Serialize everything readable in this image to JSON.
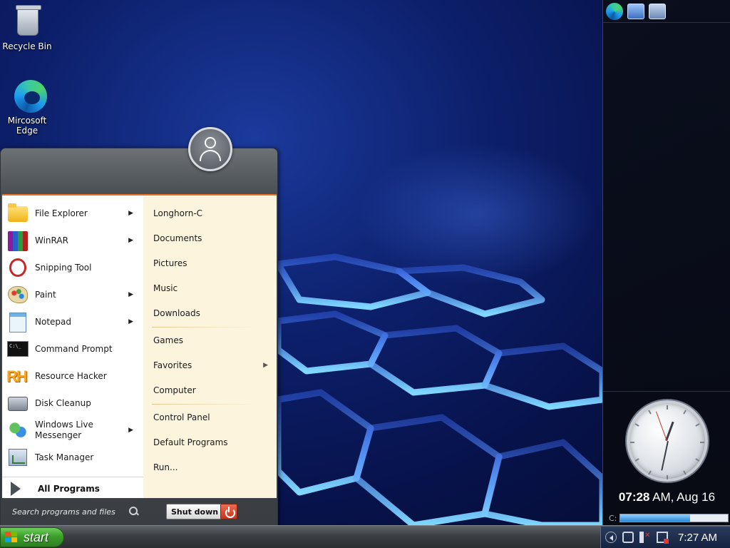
{
  "desktop": {
    "icons": [
      {
        "label": "Recycle Bin",
        "icon": "recycle-bin-icon"
      },
      {
        "label": "Mircosoft\nEdge",
        "icon": "edge-icon"
      }
    ]
  },
  "sidebar": {
    "toolbar_icons": [
      "edge-icon",
      "show-desktop-icon",
      "switch-windows-icon"
    ],
    "clock": {
      "time": "07:28",
      "suffix": " AM, Aug 16"
    },
    "drive": {
      "label": "C:",
      "used_fraction": 0.65
    }
  },
  "start_menu": {
    "programs": [
      {
        "label": "File Explorer",
        "icon": "file-explorer-icon",
        "has_submenu": true
      },
      {
        "label": "WinRAR",
        "icon": "winrar-icon",
        "has_submenu": true
      },
      {
        "label": "Snipping Tool",
        "icon": "snipping-tool-icon",
        "has_submenu": false
      },
      {
        "label": "Paint",
        "icon": "paint-icon",
        "has_submenu": true
      },
      {
        "label": "Notepad",
        "icon": "notepad-icon",
        "has_submenu": true
      },
      {
        "label": "Command Prompt",
        "icon": "command-prompt-icon",
        "has_submenu": false
      },
      {
        "label": "Resource Hacker",
        "icon": "resource-hacker-icon",
        "has_submenu": false
      },
      {
        "label": "Disk Cleanup",
        "icon": "disk-cleanup-icon",
        "has_submenu": false
      },
      {
        "label": "Windows Live Messenger",
        "icon": "messenger-icon",
        "has_submenu": true
      },
      {
        "label": "Task Manager",
        "icon": "task-manager-icon",
        "has_submenu": false
      }
    ],
    "all_programs": "All Programs",
    "places": [
      {
        "label": "Longhorn-C"
      },
      {
        "label": "Documents"
      },
      {
        "label": "Pictures"
      },
      {
        "label": "Music"
      },
      {
        "label": "Downloads"
      },
      {
        "label": "Games"
      },
      {
        "label": "Favorites",
        "has_submenu": true
      },
      {
        "label": "Computer"
      },
      {
        "label": "Control Panel"
      },
      {
        "label": "Default Programs"
      },
      {
        "label": "Run..."
      }
    ],
    "search_placeholder": "Search programs and files",
    "shutdown_label": "Shut down"
  },
  "taskbar": {
    "start_label": "start",
    "time": "7:27 AM"
  }
}
